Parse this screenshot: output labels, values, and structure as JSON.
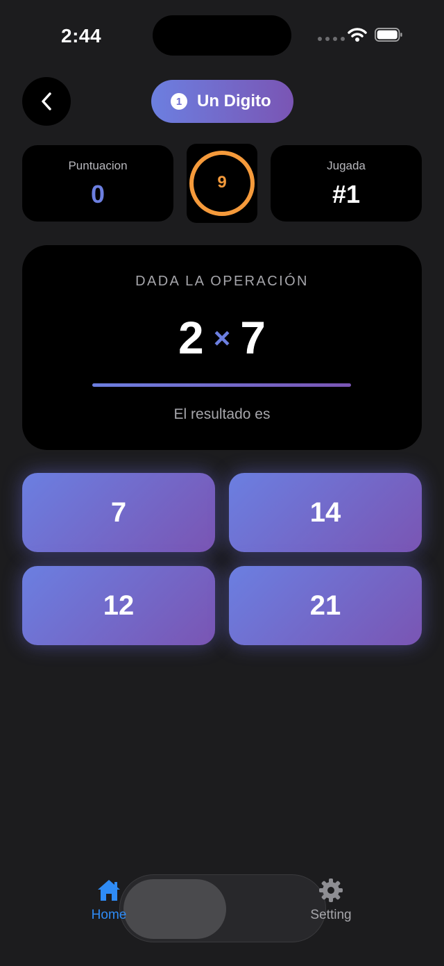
{
  "status_bar": {
    "time": "2:44"
  },
  "header": {
    "mode_number": "1",
    "mode_title": "Un Digito"
  },
  "stats": {
    "score_label": "Puntuacion",
    "score_value": "0",
    "timer_value": "9",
    "play_label": "Jugada",
    "play_value": "#1"
  },
  "operation": {
    "label": "DADA LA OPERACIÓN",
    "operand_a": "2",
    "operator": "×",
    "operand_b": "7",
    "subtitle": "El resultado es"
  },
  "answers": [
    "7",
    "14",
    "12",
    "21"
  ],
  "tabbar": {
    "home_label": "Home",
    "setting_label": "Setting"
  },
  "colors": {
    "accent": "#6c7fe0",
    "accent_end": "#7a55b4",
    "timer": "#f59a3b",
    "tab_active": "#2f8cf6"
  },
  "icons": {
    "back": "chevron-left-icon",
    "home": "house-icon",
    "setting": "gear-icon"
  }
}
